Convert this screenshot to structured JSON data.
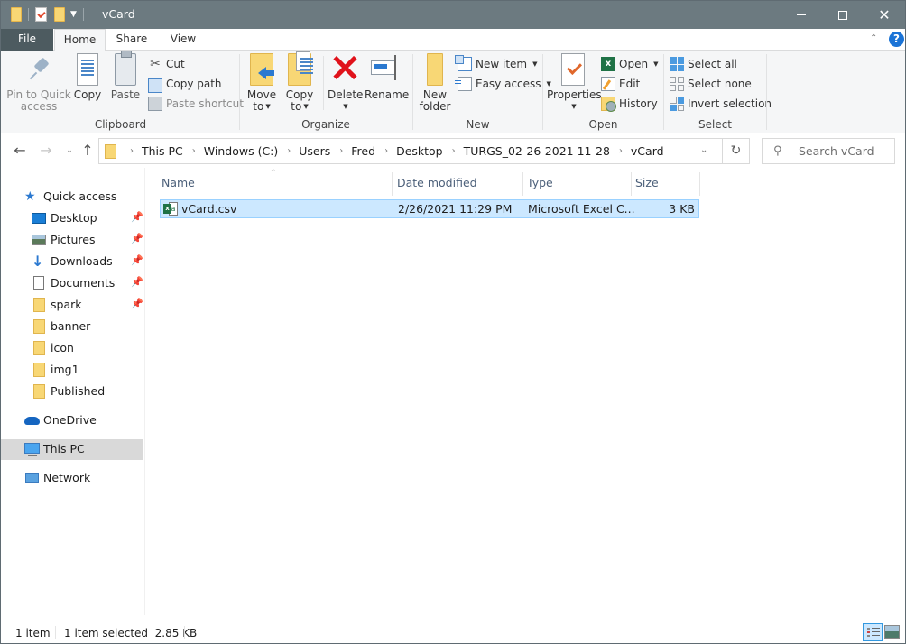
{
  "window": {
    "title": "vCard",
    "controls": {
      "minimize": "minimize",
      "maximize": "maximize",
      "close": "close"
    }
  },
  "ribbon_tabs": [
    {
      "label": "File",
      "active": false
    },
    {
      "label": "Home",
      "active": true
    },
    {
      "label": "Share",
      "active": false
    },
    {
      "label": "View",
      "active": false
    }
  ],
  "ribbon": {
    "clipboard": {
      "label": "Clipboard",
      "pin": "Pin to Quick access",
      "pin_line1": "Pin to Quick",
      "pin_line2": "access",
      "copy": "Copy",
      "paste": "Paste",
      "cut": "Cut",
      "copy_path": "Copy path",
      "paste_shortcut": "Paste shortcut"
    },
    "organize": {
      "label": "Organize",
      "move_to_line1": "Move",
      "move_to_line2": "to",
      "copy_to_line1": "Copy",
      "copy_to_line2": "to",
      "delete": "Delete",
      "rename": "Rename"
    },
    "new": {
      "label": "New",
      "new_folder_line1": "New",
      "new_folder_line2": "folder",
      "new_item": "New item",
      "easy_access": "Easy access"
    },
    "open": {
      "label": "Open",
      "properties": "Properties",
      "open": "Open",
      "edit": "Edit",
      "history": "History"
    },
    "select": {
      "label": "Select",
      "select_all": "Select all",
      "select_none": "Select none",
      "invert_selection": "Invert selection"
    }
  },
  "address": {
    "breadcrumbs": [
      "This PC",
      "Windows (C:)",
      "Users",
      "Fred",
      "Desktop",
      "TURGS_02-26-2021 11-28",
      "vCard"
    ],
    "search_placeholder": "Search vCard"
  },
  "sidebar": {
    "items": [
      {
        "label": "Quick access",
        "icon": "star-icon",
        "pinned": false
      },
      {
        "label": "Desktop",
        "icon": "desktop-icon",
        "pinned": true
      },
      {
        "label": "Pictures",
        "icon": "pictures-icon",
        "pinned": true
      },
      {
        "label": "Downloads",
        "icon": "downloads-icon",
        "pinned": true
      },
      {
        "label": "Documents",
        "icon": "documents-icon",
        "pinned": true
      },
      {
        "label": "spark",
        "icon": "folder-icon",
        "pinned": true
      },
      {
        "label": "banner",
        "icon": "folder-icon",
        "pinned": false
      },
      {
        "label": "icon",
        "icon": "folder-icon",
        "pinned": false
      },
      {
        "label": "img1",
        "icon": "folder-icon",
        "pinned": false
      },
      {
        "label": "Published",
        "icon": "folder-icon",
        "pinned": false
      },
      {
        "label": "OneDrive",
        "icon": "onedrive-icon",
        "pinned": false
      },
      {
        "label": "This PC",
        "icon": "this-pc-icon",
        "pinned": false,
        "selected": true
      },
      {
        "label": "Network",
        "icon": "network-icon",
        "pinned": false
      }
    ]
  },
  "file_list": {
    "columns": [
      "Name",
      "Date modified",
      "Type",
      "Size"
    ],
    "sort_column": "Name",
    "rows": [
      {
        "name": "vCard.csv",
        "date_modified": "2/26/2021 11:29 PM",
        "type": "Microsoft Excel C...",
        "size": "3 KB",
        "selected": true
      }
    ]
  },
  "status": {
    "item_count": "1 item",
    "selection": "1 item selected  2.85 KB"
  },
  "colors": {
    "titlebar": "#6c7a80",
    "file_tab": "#4d5b60",
    "selection_bg": "#cce8ff",
    "selection_border": "#99d1ff",
    "accent": "#2b79d0"
  }
}
